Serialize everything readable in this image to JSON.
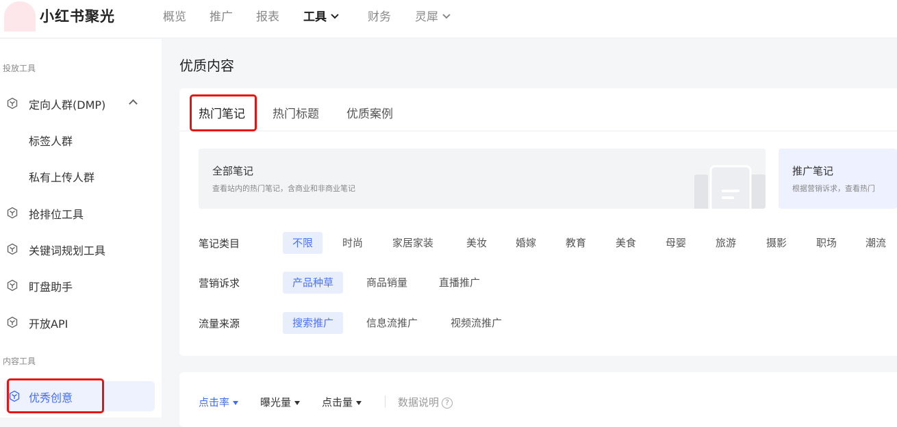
{
  "app": {
    "brand": "小红书聚光"
  },
  "topnav": [
    {
      "label": "概览"
    },
    {
      "label": "推广"
    },
    {
      "label": "报表"
    },
    {
      "label": "工具"
    },
    {
      "label": "财务"
    },
    {
      "label": "灵犀"
    }
  ],
  "sidebar": {
    "section1": "投放工具",
    "dmp": "定向人群(DMP)",
    "dmp_sub1": "标签人群",
    "dmp_sub2": "私有上传人群",
    "item_rank": "抢排位工具",
    "item_keyword": "关键词规划工具",
    "item_monitor": "盯盘助手",
    "item_api": "开放API",
    "section2": "内容工具",
    "item_creative": "优秀创意"
  },
  "main": {
    "page_title": "优质内容",
    "tabs": [
      "热门笔记",
      "热门标题",
      "优质案例"
    ],
    "feature_all": {
      "title": "全部笔记",
      "desc": "查看站内的热门笔记，含商业和非商业笔记"
    },
    "feature_promo": {
      "title": "推广笔记",
      "desc": "根据营销诉求，查看热门"
    },
    "filters": {
      "category_label": "笔记类目",
      "categories": [
        "不限",
        "时尚",
        "家居家装",
        "美妆",
        "婚嫁",
        "教育",
        "美食",
        "母婴",
        "旅游",
        "摄影",
        "职场",
        "潮流"
      ],
      "goal_label": "营销诉求",
      "goals": [
        "产品种草",
        "商品销量",
        "直播推广"
      ],
      "traffic_label": "流量来源",
      "traffic": [
        "搜索推广",
        "信息流推广",
        "视频流推广"
      ]
    },
    "metrics": [
      "点击率",
      "曝光量",
      "点击量"
    ],
    "data_help": "数据说明",
    "help_glyph": "?"
  },
  "colors": {
    "accent": "#3f6bff",
    "highlight_box": "#e8130f",
    "selected_chip_bg": "#e9eefd"
  }
}
